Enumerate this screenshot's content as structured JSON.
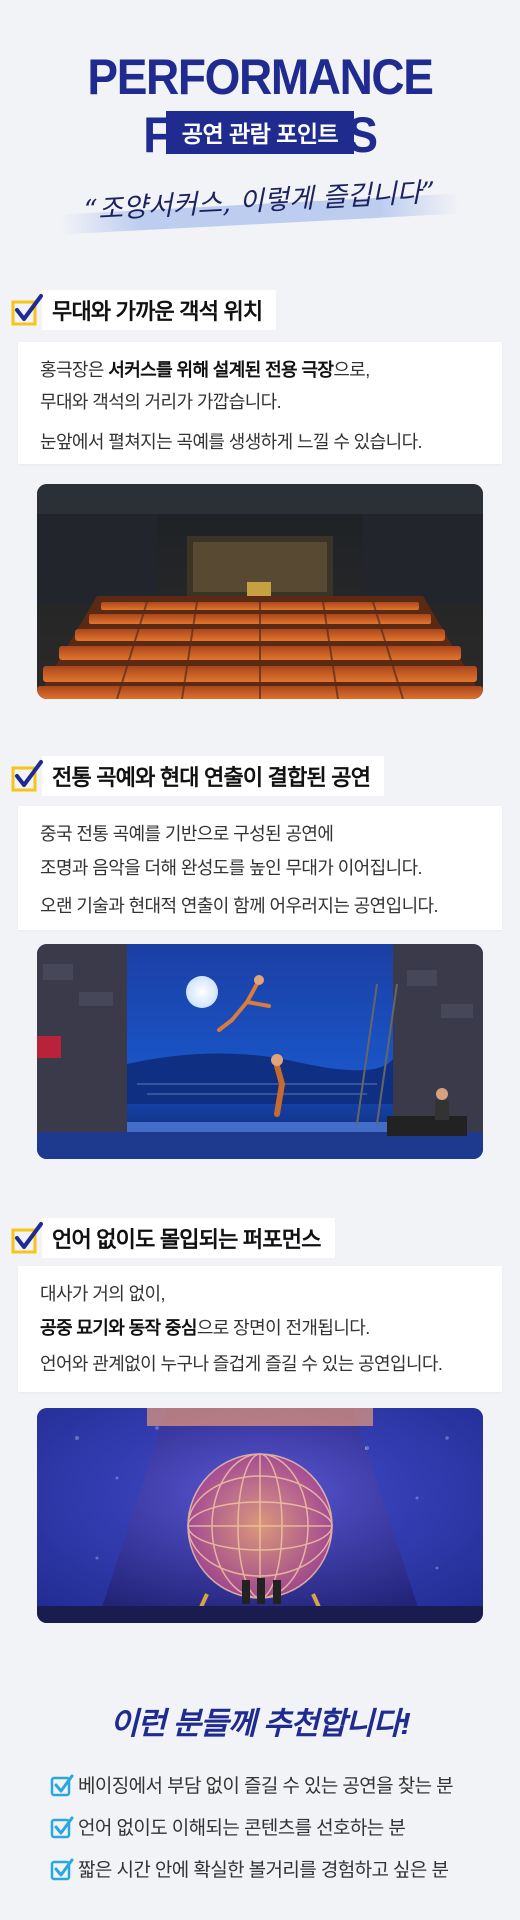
{
  "header": {
    "title": "PERFORMANCE FEATURES",
    "subtitle": "공연 관람 포인트",
    "slogan": "“조양서커스, 이렇게 즐깁니다”"
  },
  "features": [
    {
      "title": "무대와 가까운 객석 위치",
      "lines": [
        [
          "홍극장은 ",
          {
            "b": "서커스를 위해 설계된 전용 극장"
          },
          "으로,"
        ],
        [
          "무대와 객석의 거리가 가깝습니다."
        ],
        [
          "눈앞에서 펼쳐지는 곡예를 생생하게 느낄 수 있습니다."
        ]
      ]
    },
    {
      "title": "전통 곡예와 현대 연출이 결합된 공연",
      "lines": [
        [
          "중국 전통 곡예를 기반으로 구성된 공연에"
        ],
        [
          "조명과 음악을 더해 완성도를 높인 무대가 이어집니다."
        ],
        [
          "오랜 기술과 현대적 연출이 함께 어우러지는 공연입니다."
        ]
      ]
    },
    {
      "title": "언어 없이도 몰입되는 퍼포먼스",
      "lines": [
        [
          "대사가 거의 없이,"
        ],
        [
          {
            "b": "공중 묘기와 동작 중심"
          },
          "으로 장면이 전개됩니다."
        ],
        [
          "언어와 관계없이 누구나 즐겁게 즐길 수 있는 공연입니다."
        ]
      ]
    }
  ],
  "recommend": {
    "title": "이런 분들께 추천합니다!",
    "items": [
      "베이징에서 부담 없이 즐길 수 있는 공연을 찾는 분",
      "언어 없이도 이해되는 콘텐츠를 선호하는 분",
      "짧은 시간 안에 확실한 볼거리를 경험하고 싶은 분"
    ]
  },
  "colors": {
    "brand": "#1f2b8f",
    "check_yellow": "#f5c518",
    "reco_check": "#29a8e0"
  },
  "icons": {
    "feature_check": "check-icon",
    "reco_check": "checkbox-checked-icon"
  }
}
